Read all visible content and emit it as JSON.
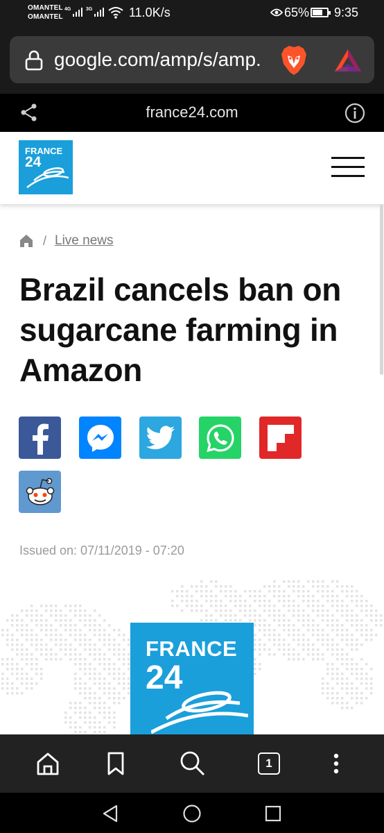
{
  "status_bar": {
    "carrier_1": "OMANTEL",
    "carrier_2": "OMANTEL",
    "signal_1_tag": "4G",
    "signal_2_tag": "3G",
    "net_speed": "11.0K/s",
    "battery_percent": "65%",
    "battery_level": 0.65,
    "time": "9:35"
  },
  "browser": {
    "url": "google.com/amp/s/amp.",
    "amp_domain": "france24.com",
    "tab_count": "1"
  },
  "site": {
    "logo_line1": "FRANCE",
    "logo_line2": "24"
  },
  "breadcrumb": {
    "link": "Live news",
    "separator": "/"
  },
  "article": {
    "headline": "Brazil cancels ban on sugarcane farming in Amazon",
    "issued": "Issued on: 07/11/2019 - 07:20"
  },
  "hero": {
    "logo_line1": "FRANCE",
    "logo_line2": "24"
  },
  "share_buttons": [
    "facebook-icon",
    "messenger-icon",
    "twitter-icon",
    "whatsapp-icon",
    "flipboard-icon",
    "reddit-icon"
  ],
  "colors": {
    "france24_blue": "#1a9fdb",
    "facebook": "#3b5998",
    "messenger": "#0084ff",
    "twitter": "#2ca7e0",
    "whatsapp": "#25d366",
    "flipboard": "#e12828",
    "reddit": "#5f99cf"
  }
}
